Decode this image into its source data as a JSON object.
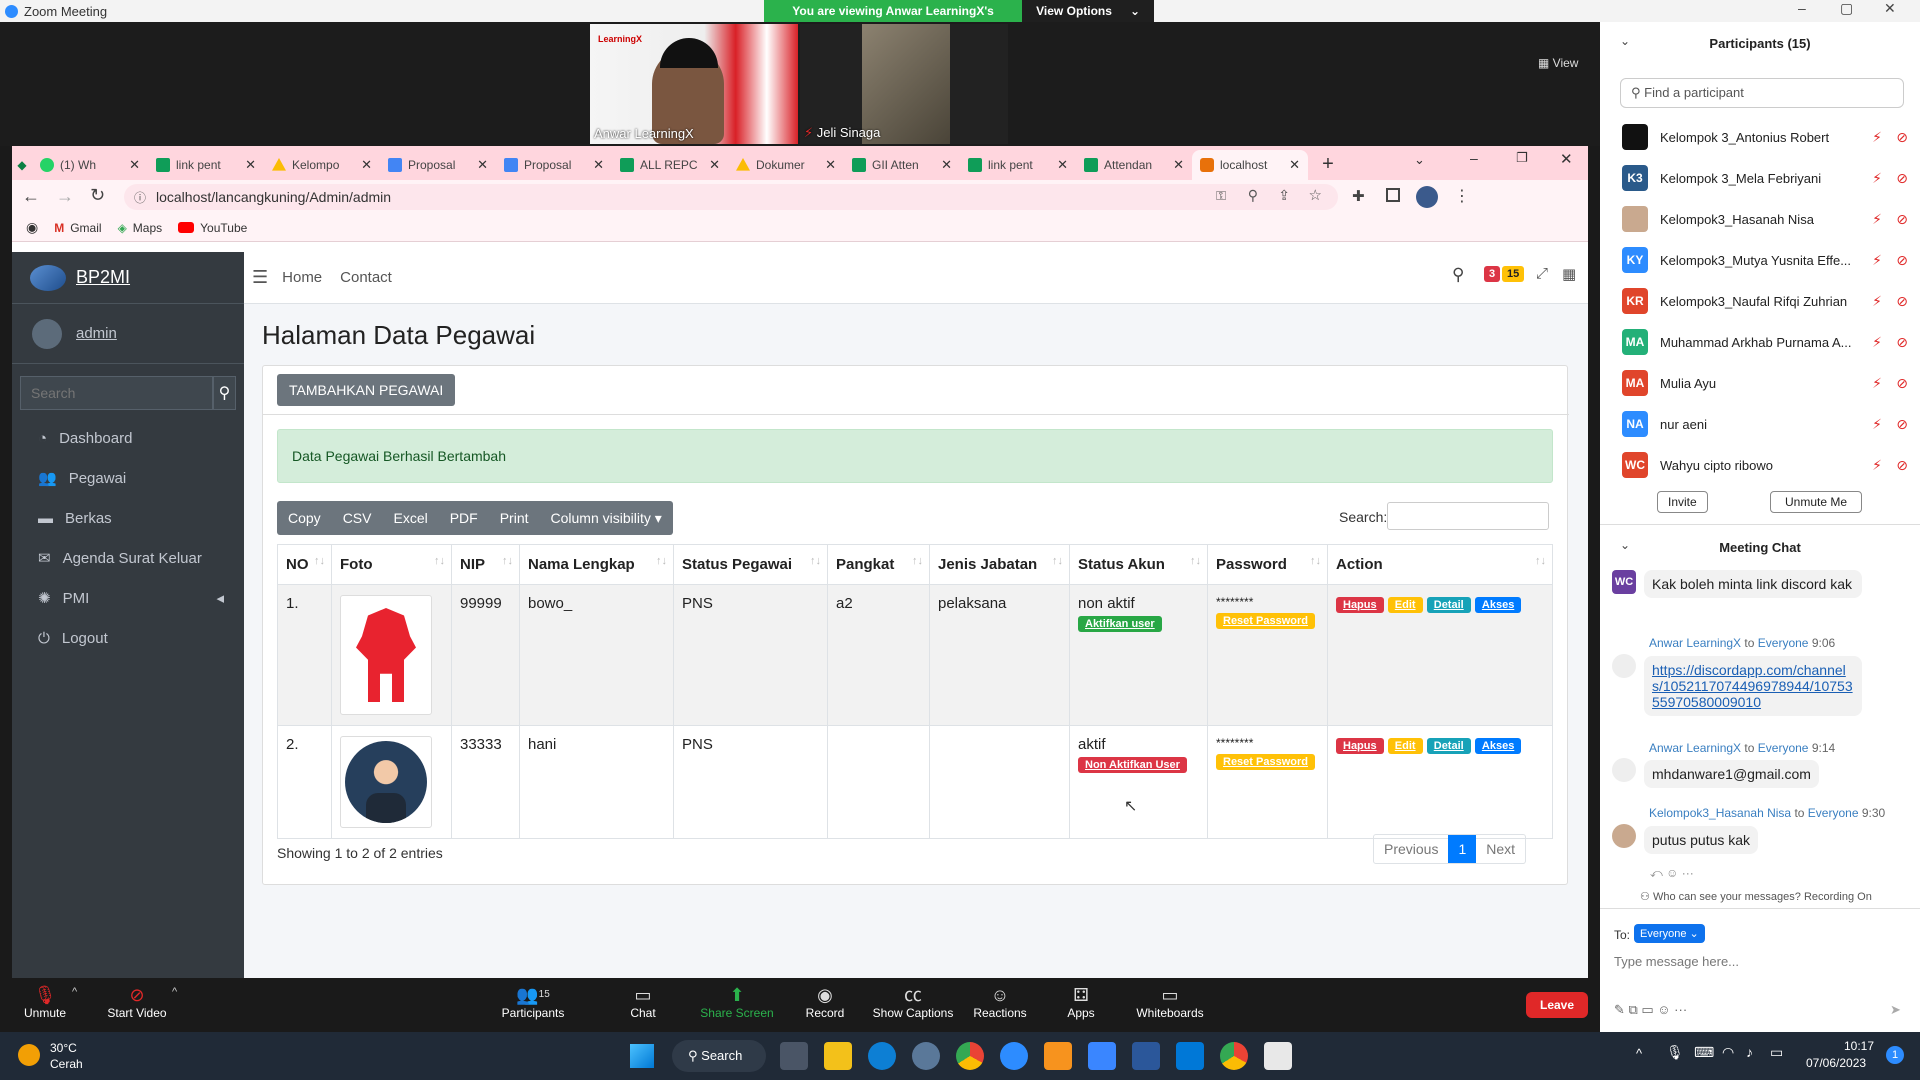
{
  "zoom": {
    "window_title": "Zoom Meeting",
    "viewing_banner": "You are viewing Anwar LearningX's screen",
    "view_options": "View Options",
    "view_label": "View",
    "videos": [
      {
        "name": "Anwar LearningX",
        "badge": "LearningX"
      },
      {
        "name": "Jeli Sinaga"
      }
    ]
  },
  "browser": {
    "tabs": [
      {
        "label": "(1) Wh",
        "icon_color": "#25d366"
      },
      {
        "label": "link pent",
        "icon_color": "#0f9d58"
      },
      {
        "label": "Kelompo",
        "icon_color": "#fbbc04"
      },
      {
        "label": "Proposal",
        "icon_color": "#4285f4"
      },
      {
        "label": "Proposal",
        "icon_color": "#4285f4"
      },
      {
        "label": "ALL REPC",
        "icon_color": "#0f9d58"
      },
      {
        "label": "Dokumer",
        "icon_color": "#fbbc04"
      },
      {
        "label": "GII Atten",
        "icon_color": "#0f9d58"
      },
      {
        "label": "link pent",
        "icon_color": "#0f9d58"
      },
      {
        "label": "Attendan",
        "icon_color": "#0f9d58"
      },
      {
        "label": "localhost",
        "icon_color": "#e8710a"
      }
    ],
    "url": "localhost/lancangkuning/Admin/admin",
    "bookmarks": [
      "Gmail",
      "Maps",
      "YouTube"
    ]
  },
  "admin": {
    "brand": "BP2MI",
    "user": "admin",
    "search_placeholder": "Search",
    "menu": [
      {
        "label": "Dashboard",
        "icon": "dashboard-icon"
      },
      {
        "label": "Pegawai",
        "icon": "users-icon"
      },
      {
        "label": "Berkas",
        "icon": "briefcase-icon"
      },
      {
        "label": "Agenda Surat Keluar",
        "icon": "envelope-icon"
      },
      {
        "label": "PMI",
        "icon": "spinner-icon"
      },
      {
        "label": "Logout",
        "icon": "power-icon"
      }
    ],
    "topnav": {
      "home": "Home",
      "contact": "Contact",
      "badge_red": "3",
      "badge_yellow": "15"
    },
    "page_title": "Halaman Data Pegawai",
    "add_button": "TAMBAHKAN PEGAWAI",
    "alert": "Data Pegawai Berhasil Bertambah",
    "dt_buttons": [
      "Copy",
      "CSV",
      "Excel",
      "PDF",
      "Print",
      "Column visibility"
    ],
    "search_label": "Search:",
    "columns": [
      "NO",
      "Foto",
      "NIP",
      "Nama Lengkap",
      "Status Pegawai",
      "Pangkat",
      "Jenis Jabatan",
      "Status Akun",
      "Password",
      "Action"
    ],
    "rows": [
      {
        "no": "1.",
        "nip": "99999",
        "nama": "bowo_",
        "status": "PNS",
        "pangkat": "a2",
        "jabatan": "pelaksana",
        "akun": "non aktif",
        "akun_btn": "Aktifkan user",
        "password": "********",
        "reset": "Reset Password"
      },
      {
        "no": "2.",
        "nip": "33333",
        "nama": "hani",
        "status": "PNS",
        "pangkat": "",
        "jabatan": "",
        "akun": "aktif",
        "akun_btn": "Non Aktifkan User",
        "password": "********",
        "reset": "Reset Password"
      }
    ],
    "actions": [
      "Hapus",
      "Edit",
      "Detail",
      "Akses"
    ],
    "info": "Showing 1 to 2 of 2 entries",
    "pagination": {
      "prev": "Previous",
      "page": "1",
      "next": "Next"
    }
  },
  "participants": {
    "title": "Participants (15)",
    "search_placeholder": "Find a participant",
    "list": [
      {
        "initials": "",
        "name": "Kelompok 3_Antonius Robert",
        "color": "#111111"
      },
      {
        "initials": "K3",
        "name": "Kelompok 3_Mela Febriyani",
        "color": "#2a5a8a"
      },
      {
        "initials": "",
        "name": "Kelompok3_Hasanah Nisa",
        "color": "#c9a98f"
      },
      {
        "initials": "KY",
        "name": "Kelompok3_Mutya Yusnita Effe...",
        "color": "#2d8cff"
      },
      {
        "initials": "KR",
        "name": "Kelompok3_Naufal Rifqi Zuhrian",
        "color": "#e0452b"
      },
      {
        "initials": "MA",
        "name": "Muhammad Arkhab Purnama A...",
        "color": "#23b078"
      },
      {
        "initials": "MA",
        "name": "Mulia Ayu",
        "color": "#e0452b"
      },
      {
        "initials": "NA",
        "name": "nur aeni",
        "color": "#2d8cff"
      },
      {
        "initials": "WC",
        "name": "Wahyu cipto ribowo",
        "color": "#e0452b"
      }
    ],
    "invite": "Invite",
    "unmute": "Unmute Me"
  },
  "chat": {
    "title": "Meeting Chat",
    "messages": [
      {
        "text": "Kak boleh minta link discord kak"
      },
      {
        "sender": "Anwar LearningX",
        "to": "to",
        "recipient": "Everyone",
        "time": "9:06",
        "link": "https://discordapp.com/channels/1052117074496978944/1075355970580009010"
      },
      {
        "sender": "Anwar LearningX",
        "to": "to",
        "recipient": "Everyone",
        "time": "9:14",
        "text": "mhdanware1@gmail.com"
      },
      {
        "sender": "Kelompok3_Hasanah Nisa",
        "to": "to",
        "recipient": "Everyone",
        "time": "9:30",
        "text": "putus putus kak"
      }
    ],
    "who_can_see": "Who can see your messages? Recording On",
    "to_label": "To:",
    "to_value": "Everyone",
    "input_placeholder": "Type message here..."
  },
  "toolbar": {
    "items": [
      "Unmute",
      "Start Video",
      "Participants",
      "Chat",
      "Share Screen",
      "Record",
      "Show Captions",
      "Reactions",
      "Apps",
      "Whiteboards"
    ],
    "participants_count": "15",
    "leave": "Leave"
  },
  "taskbar": {
    "weather_temp": "30°C",
    "weather_desc": "Cerah",
    "search": "Search",
    "time": "10:17",
    "date": "07/06/2023",
    "notif": "1"
  }
}
